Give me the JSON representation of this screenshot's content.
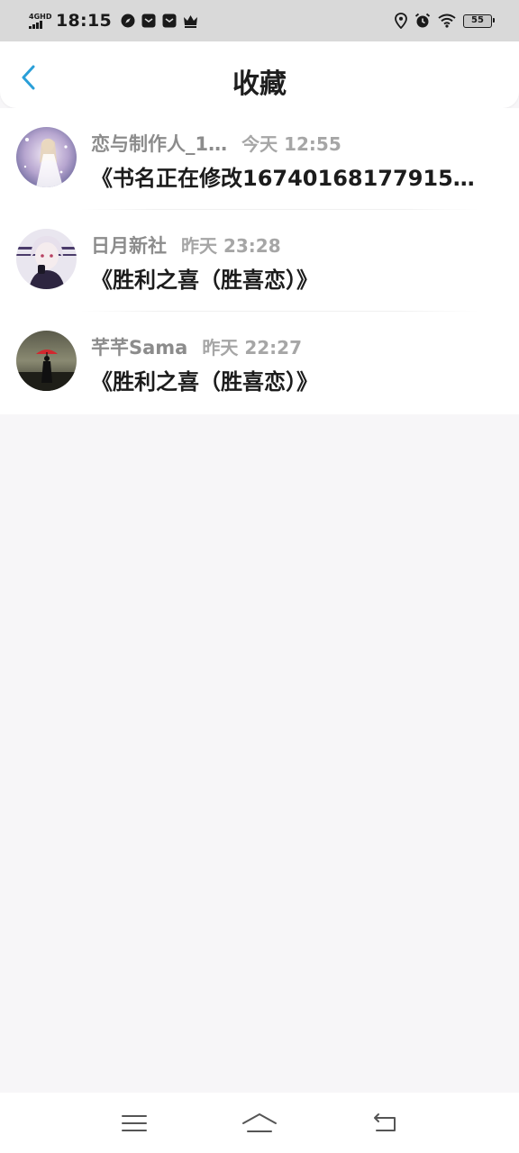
{
  "status_bar": {
    "network": "4GHD",
    "time": "18:15",
    "battery": "55"
  },
  "header": {
    "title": "收藏"
  },
  "favorites": [
    {
      "author": "恋与制作人_1…",
      "time": "今天 12:55",
      "book_title": "《书名正在修改16740168177915…"
    },
    {
      "author": "日月新社",
      "time": "昨天 23:28",
      "book_title": "《胜利之喜（胜喜恋）》"
    },
    {
      "author": "芊芊Sama",
      "time": "昨天 22:27",
      "book_title": "《胜利之喜（胜喜恋）》"
    }
  ],
  "colors": {
    "accent": "#2a9fd8",
    "page_background": "#f7f6f8",
    "status_bar_background": "#d9d9d9"
  }
}
